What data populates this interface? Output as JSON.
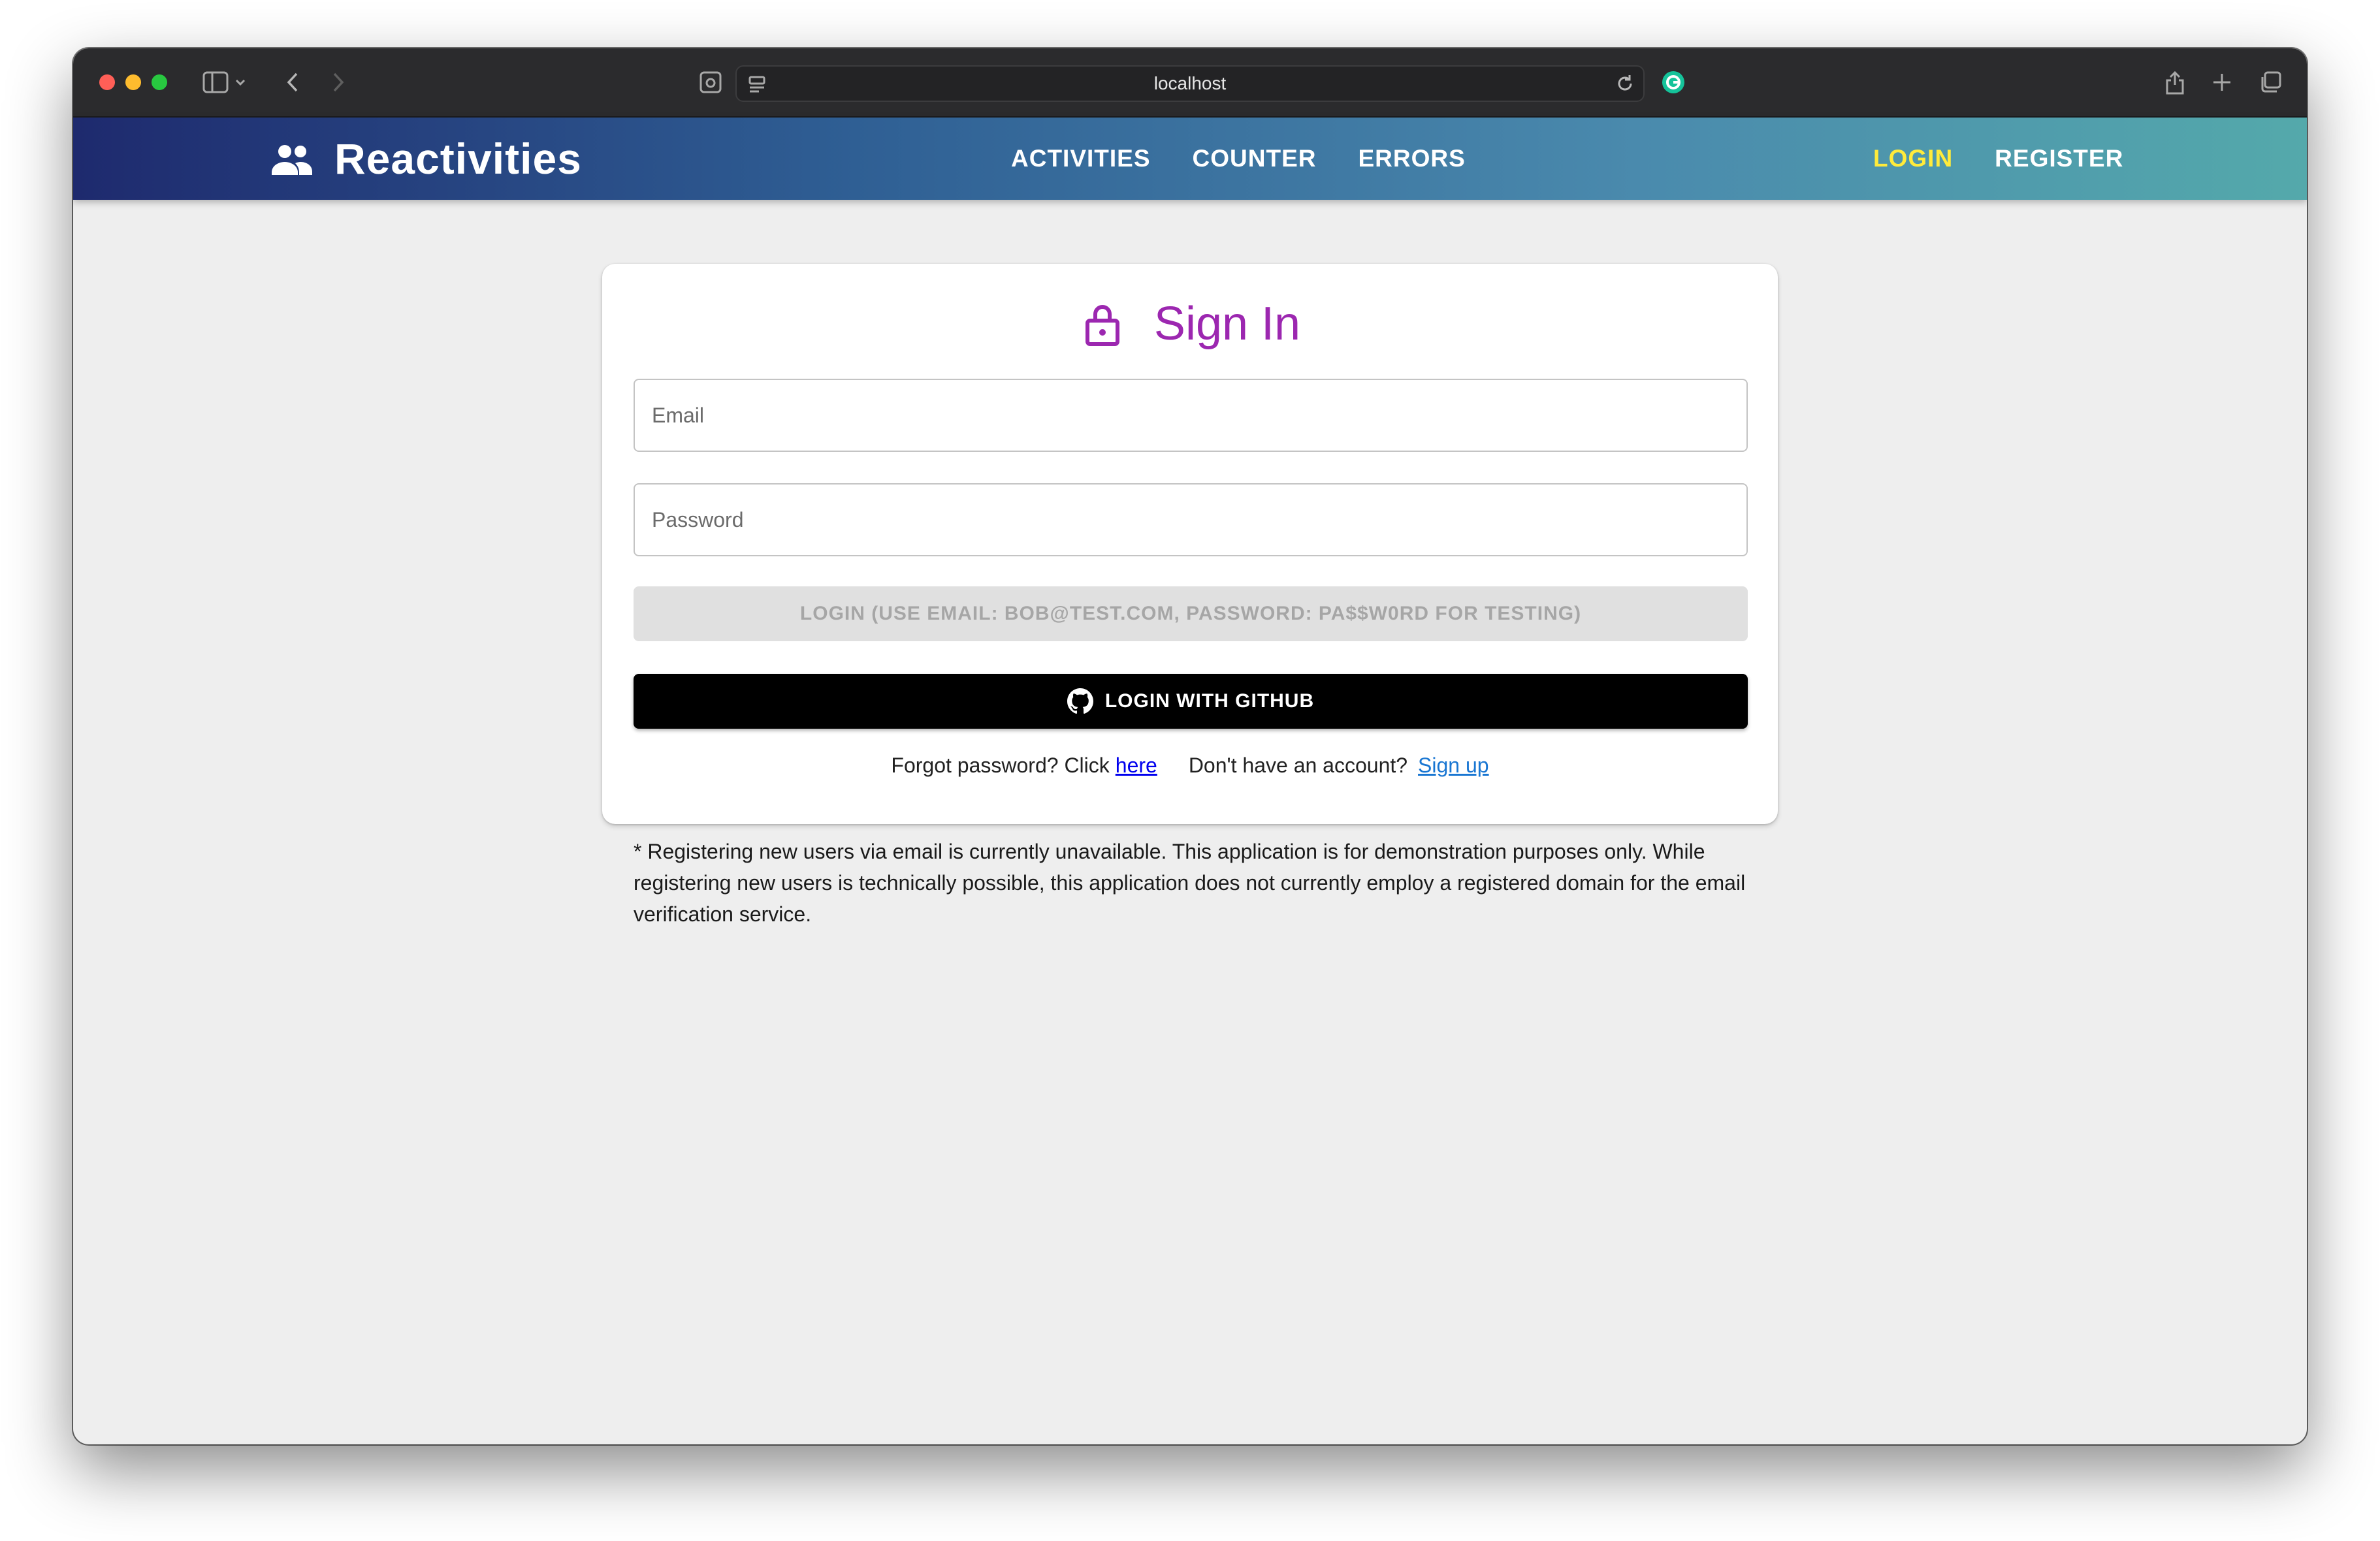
{
  "browser": {
    "url": "localhost"
  },
  "app": {
    "brand": "Reactivities",
    "nav": {
      "center": [
        "ACTIVITIES",
        "COUNTER",
        "ERRORS"
      ],
      "right": [
        "LOGIN",
        "REGISTER"
      ],
      "active": "LOGIN"
    },
    "colors": {
      "accent_purple": "#9c27b0",
      "active_nav": "#ffeb3b",
      "link_blue": "#1976d2"
    }
  },
  "form": {
    "title": "Sign In",
    "email_label": "Email",
    "password_label": "Password",
    "login_button": "LOGIN (USE EMAIL: BOB@TEST.COM, PASSWORD: PA$$W0RD FOR TESTING)",
    "github_button": "LOGIN WITH GITHUB",
    "forgot_text": "Forgot password? Click",
    "forgot_link": "here",
    "no_account_text": "Don't have an account?",
    "signup_link": "Sign up"
  },
  "disclaimer": "* Registering new users via email is currently unavailable. This application is for demonstration purposes only. While registering new users is technically possible, this application does not currently employ a registered domain for the email verification service."
}
